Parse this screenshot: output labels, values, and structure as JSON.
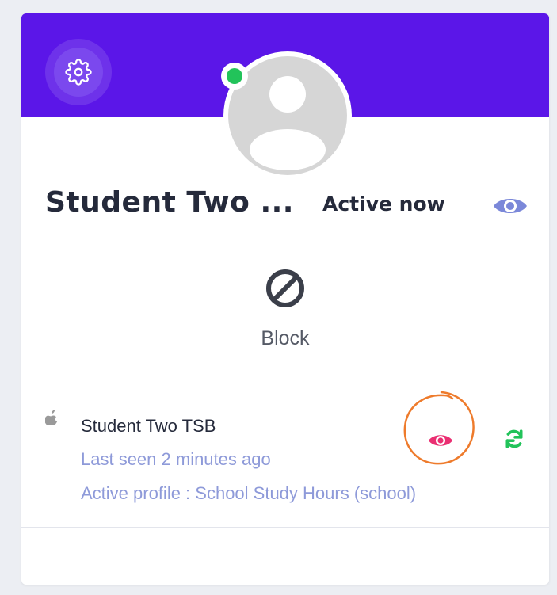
{
  "profile": {
    "name": "Student Two ...",
    "status": "Active now",
    "online": true
  },
  "actions": {
    "block_label": "Block"
  },
  "device": {
    "platform_icon": "apple-icon",
    "name": "Student Two TSB",
    "last_seen": "Last seen 2 minutes ago",
    "active_profile": "Active profile : School Study Hours (school)"
  },
  "colors": {
    "header": "#5b16e8",
    "online": "#22c35a",
    "eye_view": "#7b88d9",
    "eye_pink": "#ea2f72",
    "refresh": "#22c35a",
    "highlight": "#ee7b2c",
    "muted_text": "#8e9ad9"
  }
}
